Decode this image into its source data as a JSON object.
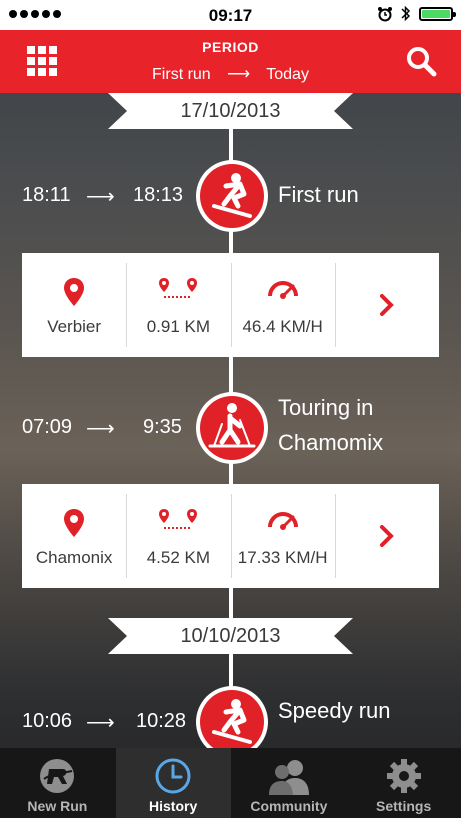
{
  "status_bar": {
    "time": "09:17"
  },
  "header": {
    "title": "PERIOD",
    "range_from": "First run",
    "range_arrow": "⟶",
    "range_to": "Today"
  },
  "timeline": {
    "dates": [
      "17/10/2013",
      "10/10/2013"
    ],
    "runs": [
      {
        "start": "18:11",
        "arrow": "⟶",
        "end": "18:13",
        "name": "First run",
        "activity_icon": "snowboard-icon",
        "location": "Verbier",
        "distance": "0.91 KM",
        "speed": "46.4 KM/H"
      },
      {
        "start": "07:09",
        "arrow": "⟶",
        "end": "9:35",
        "name_line1": "Touring in",
        "name_line2": "Chamomix",
        "activity_icon": "ski-touring-icon",
        "location": "Chamonix",
        "distance": "4.52 KM",
        "speed": "17.33 KM/H"
      },
      {
        "start": "10:06",
        "arrow": "⟶",
        "end": "10:28",
        "name": "Speedy run",
        "activity_icon": "snowboard-icon"
      }
    ]
  },
  "tabbar": {
    "items": [
      {
        "label": "New Run",
        "icon": "rossignol-logo-icon"
      },
      {
        "label": "History",
        "icon": "clock-icon",
        "active": true
      },
      {
        "label": "Community",
        "icon": "people-icon"
      },
      {
        "label": "Settings",
        "icon": "gear-icon"
      }
    ]
  },
  "colors": {
    "accent": "#e8242a",
    "card_text": "#3b3b3b",
    "tabbar_bg": "#171717"
  }
}
